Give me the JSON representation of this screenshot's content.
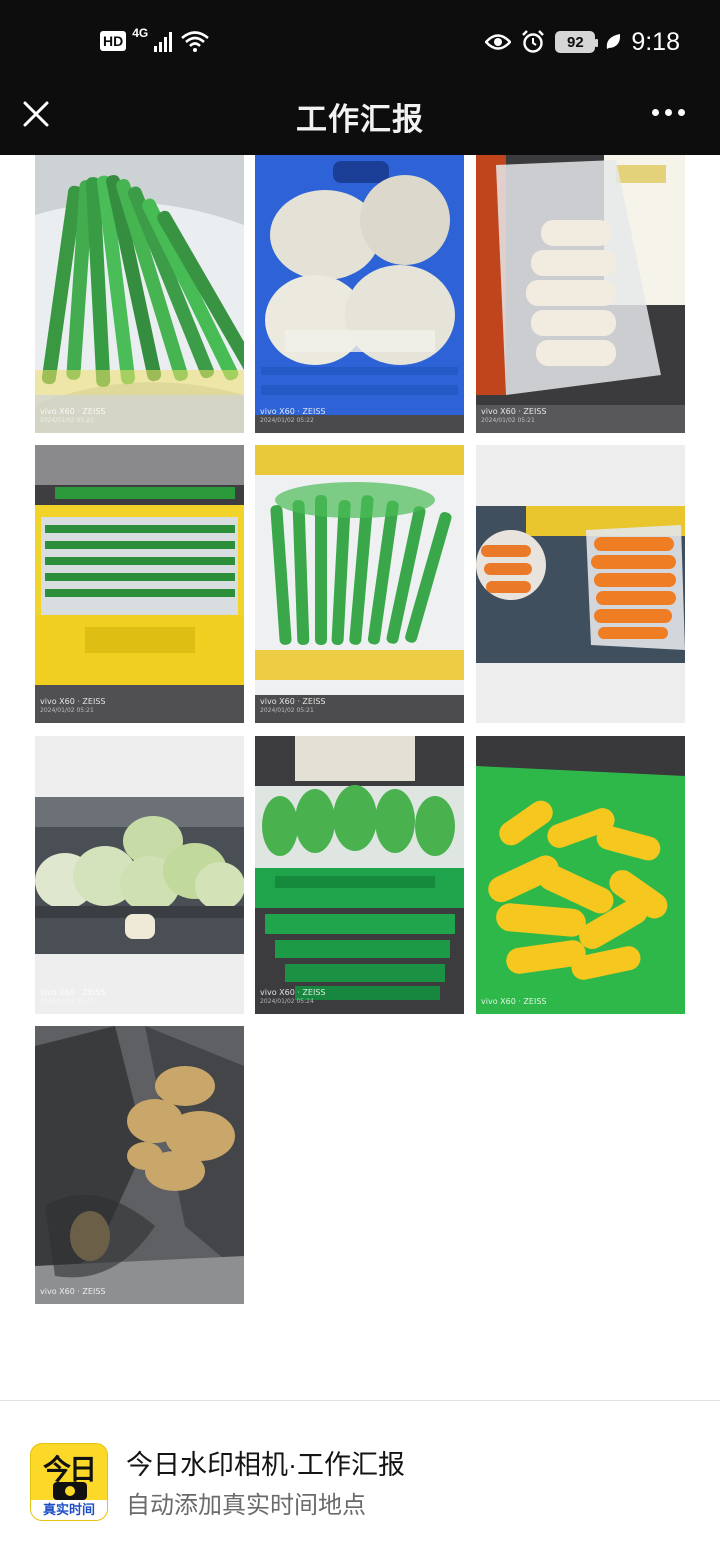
{
  "status_bar": {
    "hd": "HD",
    "network": "4G",
    "battery": "92",
    "time": "9:18"
  },
  "nav": {
    "title": "工作汇报"
  },
  "photos": [
    {
      "device": "vivo X60 · ZEISS",
      "date": "2024/01/02 05:22"
    },
    {
      "device": "vivo X60 · ZEISS",
      "date": "2024/01/02 05:22"
    },
    {
      "device": "vivo X60 · ZEISS",
      "date": "2024/01/02 05:21"
    },
    {
      "device": "vivo X60 · ZEISS",
      "date": "2024/01/02 05:21"
    },
    {
      "device": "vivo X60 · ZEISS",
      "date": "2024/01/02 05:21"
    },
    {
      "device": "",
      "date": ""
    },
    {
      "device": "vivo X60 · ZEISS",
      "date": "2024/01/02 05:21"
    },
    {
      "device": "vivo X60 · ZEISS",
      "date": "2024/01/02 05:24"
    },
    {
      "device": "vivo X60 · ZEISS",
      "date": ""
    },
    {
      "device": "vivo X60 · ZEISS",
      "date": ""
    }
  ],
  "footer": {
    "icon_text": "今日",
    "icon_strip": "真实时间",
    "app_name": "今日水印相机·工作汇报",
    "app_subtitle": "自动添加真实时间地点"
  },
  "colors": {
    "bar_bg": "#0d0d0d",
    "icon_yellow": "#fcd829",
    "icon_blue": "#1f4fc7"
  }
}
